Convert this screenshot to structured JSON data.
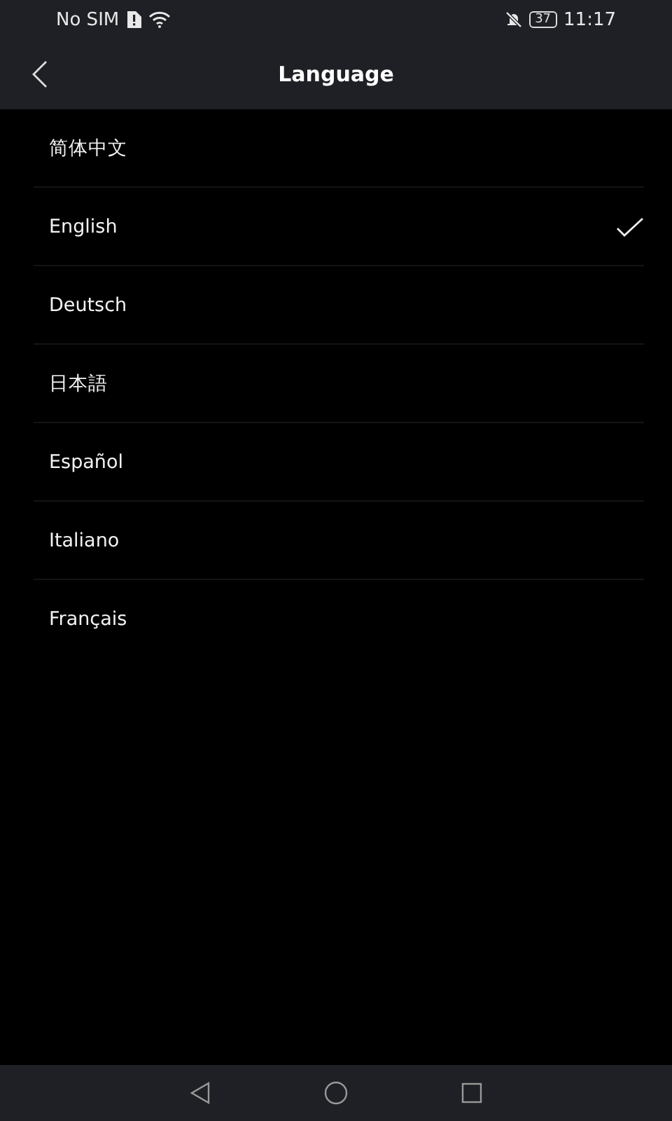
{
  "status_bar": {
    "carrier": "No SIM",
    "battery": "37",
    "time": "11:17"
  },
  "header": {
    "title": "Language"
  },
  "languages": [
    {
      "label": "简体中文",
      "selected": false
    },
    {
      "label": "English",
      "selected": true
    },
    {
      "label": "Deutsch",
      "selected": false
    },
    {
      "label": "日本語",
      "selected": false
    },
    {
      "label": "Español",
      "selected": false
    },
    {
      "label": "Italiano",
      "selected": false
    },
    {
      "label": "Français",
      "selected": false
    }
  ]
}
